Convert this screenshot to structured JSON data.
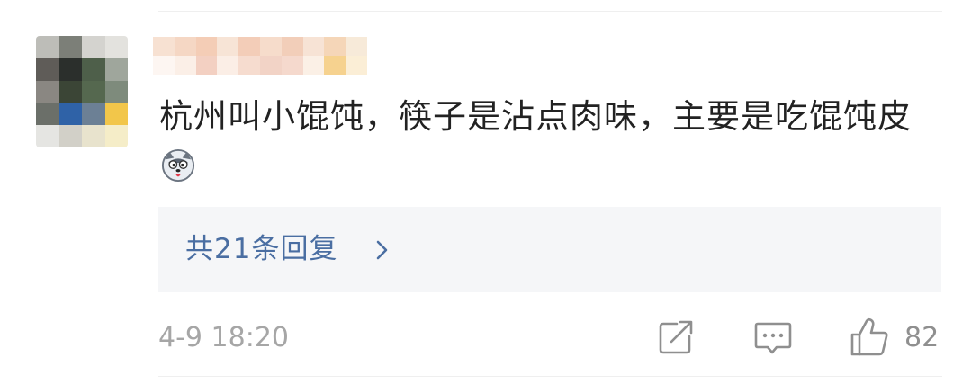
{
  "comment": {
    "text": "杭州叫小馄饨，筷子是沾点肉味，主要是吃馄饨皮",
    "emoji_icon": "husky-dog-emoji-icon"
  },
  "replies": {
    "label": "共21条回复",
    "chevron_icon": "chevron-right-icon",
    "link_color": "#4a6ea2"
  },
  "footer": {
    "timestamp": "4-9 18:20",
    "share_icon": "share-arrow-icon",
    "comment_icon": "comment-bubble-icon",
    "like_icon": "thumbs-up-icon",
    "like_count": "82"
  },
  "avatar": {
    "state": "pixelated"
  },
  "username": {
    "state": "pixelated"
  },
  "colors": {
    "text": "#222222",
    "muted": "#a6a6a6",
    "reply_bg": "#f5f6f8"
  }
}
